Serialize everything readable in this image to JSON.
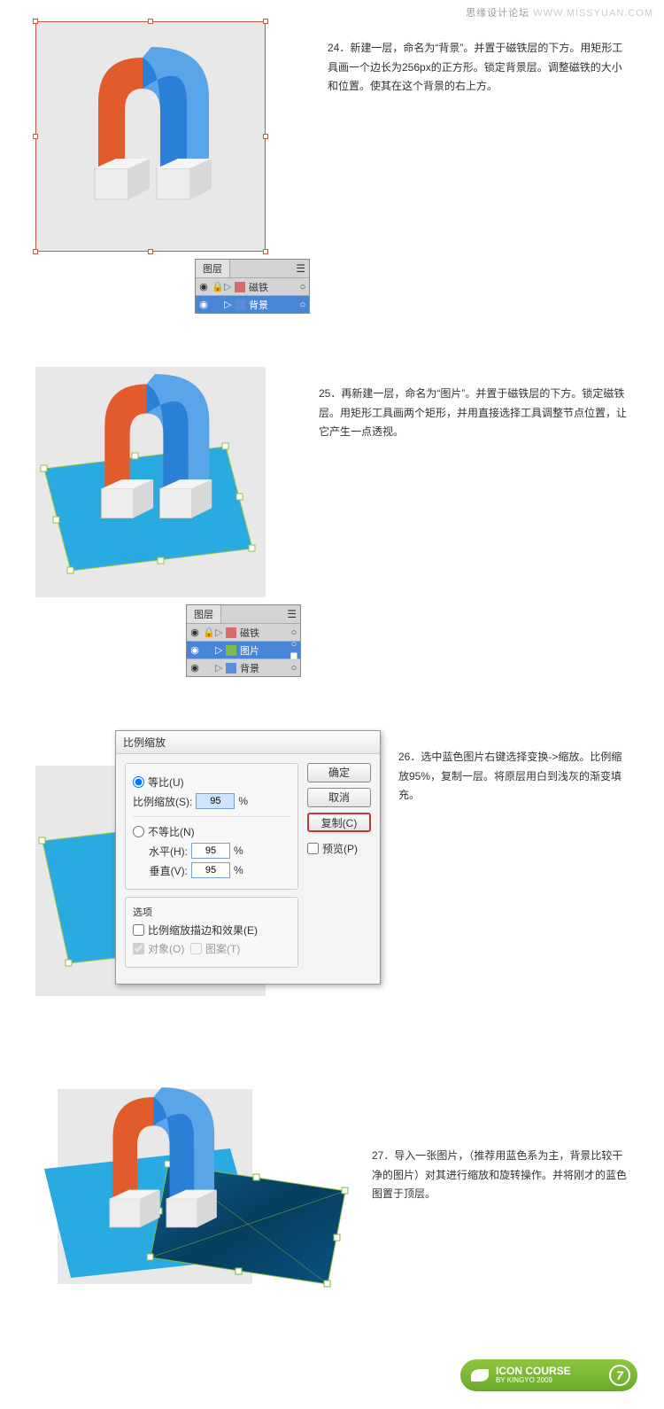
{
  "header": {
    "forum": "思缘设计论坛",
    "url": "WWW.MISSYUAN.COM"
  },
  "steps": {
    "s24": {
      "num": "24．",
      "text": "新建一层，命名为“背景”。并置于磁铁层的下方。用矩形工具画一个边长为256px的正方形。锁定背景层。调整磁铁的大小和位置。使其在这个背景的右上方。"
    },
    "s25": {
      "num": "25．",
      "text": "再新建一层，命名为“图片”。并置于磁铁层的下方。锁定磁铁层。用矩形工具画两个矩形，并用直接选择工具调整节点位置，让它产生一点透视。"
    },
    "s26": {
      "num": "26．",
      "text": "选中蓝色图片右键选择变换->缩放。比例缩放95%，复制一层。将原层用白到浅灰的渐变填充。"
    },
    "s27": {
      "num": "27．",
      "text": "导入一张图片，（推荐用蓝色系为主，背景比较干净的图片）对其进行缩放和旋转操作。并将刚才的蓝色图置于顶层。"
    }
  },
  "layers_panel": {
    "title": "图层",
    "rows24": [
      {
        "name": "磁铁",
        "color": "#d86b6b",
        "selected": false
      },
      {
        "name": "背景",
        "color": "#5a8dd8",
        "selected": true
      }
    ],
    "rows25": [
      {
        "name": "磁铁",
        "color": "#d86b6b",
        "selected": false
      },
      {
        "name": "图片",
        "color": "#7db946",
        "selected": true
      },
      {
        "name": "背景",
        "color": "#5a8dd8",
        "selected": false
      }
    ]
  },
  "dialog": {
    "title": "比例缩放",
    "uniform": "等比(U)",
    "scale_label": "比例缩放(S):",
    "scale_value": "95",
    "nonuniform": "不等比(N)",
    "h_label": "水平(H):",
    "h_value": "95",
    "v_label": "垂直(V):",
    "v_value": "95",
    "options": "选项",
    "opt_stroke": "比例缩放描边和效果(E)",
    "opt_object": "对象(O)",
    "opt_pattern": "图案(T)",
    "ok": "确定",
    "cancel": "取消",
    "copy": "复制(C)",
    "preview": "预览(P)",
    "pct": "%"
  },
  "badge": {
    "title": "ICON COURSE",
    "subtitle": "BY KINGYO 2009",
    "page": "7"
  }
}
